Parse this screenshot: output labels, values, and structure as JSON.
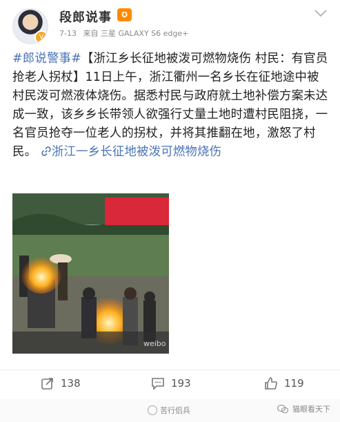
{
  "post": {
    "author": "段郎说事",
    "date": "7-13",
    "source": "来自 三星 GALAXY S6 edge+",
    "hashtag": "#郎说警事#",
    "text_part1": "【浙江乡长征地被泼可燃物烧伤 村民：有官员抢老人拐杖】11日上午，浙江衢州一名乡长在征地途中被村民泼可燃液体烧伤。据悉村民与政府就土地补偿方案未达成一致，该乡乡长带领人欲强行丈量土地时遭村民阻挠，一名官员抢夺一位老人的拐杖，并将其推翻在地，激怒了村民。",
    "link_text": "浙江一乡长征地被泼可燃物烧伤",
    "image_watermark": "weibo"
  },
  "actions": {
    "repost_count": "138",
    "comment_count": "193",
    "like_count": "119"
  },
  "footer": {
    "center_text": "苦行侣兵",
    "right_text": "猫眼看天下"
  },
  "icons": {
    "avatar_badge": "verified-badge-icon",
    "vip": "vip-icon",
    "chevron": "chevron-down-icon",
    "repost": "repost-icon",
    "comment": "comment-icon",
    "like": "thumbs-up-icon",
    "link": "link-icon"
  },
  "colors": {
    "link_blue": "#4a74b8",
    "fire": "#ffb020",
    "banner_red": "#d8283a"
  }
}
